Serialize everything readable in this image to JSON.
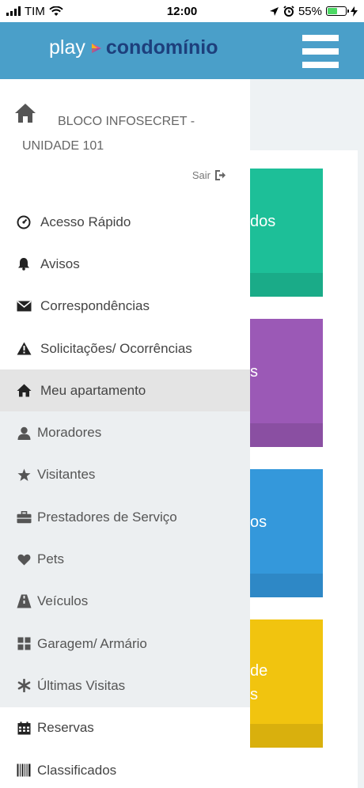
{
  "status_bar": {
    "carrier": "TIM",
    "time": "12:00",
    "battery": "55%"
  },
  "header": {
    "logo_play": "play",
    "logo_name": "condomínio"
  },
  "drawer": {
    "unit": "BLOCO INFOSECRET - UNIDADE 101",
    "logout_label": "Sair",
    "menu": [
      {
        "label": "Acesso Rápido",
        "icon": "speedometer-icon"
      },
      {
        "label": "Avisos",
        "icon": "bell-icon"
      },
      {
        "label": "Correspondências",
        "icon": "envelope-icon"
      },
      {
        "label": "Solicitações/ Ocorrências",
        "icon": "warning-icon"
      },
      {
        "label": "Meu apartamento",
        "icon": "home-icon"
      },
      {
        "label": "Moradores",
        "icon": "user-icon"
      },
      {
        "label": "Visitantes",
        "icon": "star-icon"
      },
      {
        "label": "Prestadores de Serviço",
        "icon": "briefcase-icon"
      },
      {
        "label": "Pets",
        "icon": "heart-icon"
      },
      {
        "label": "Veículos",
        "icon": "road-icon"
      },
      {
        "label": "Garagem/ Armário",
        "icon": "grid-icon"
      },
      {
        "label": "Últimas Visitas",
        "icon": "asterisk-icon"
      },
      {
        "label": "Reservas",
        "icon": "calendar-icon"
      },
      {
        "label": "Classificados",
        "icon": "barcode-icon"
      }
    ]
  },
  "tiles": [
    {
      "text": "dos",
      "color": "#1dbf98",
      "strip": "#1aab88"
    },
    {
      "text": "s",
      "color": "#9b59b6",
      "strip": "#8a4fa2"
    },
    {
      "text": "os",
      "color": "#3498db",
      "strip": "#2e88c6"
    },
    {
      "text": "de",
      "text2": "s",
      "color": "#f1c40f",
      "strip": "#d9b00d"
    }
  ]
}
